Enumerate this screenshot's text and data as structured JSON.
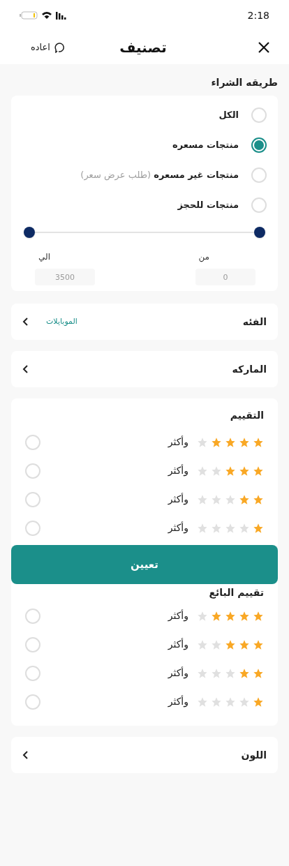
{
  "status_bar": {
    "time": "2:18"
  },
  "header": {
    "title": "تصنيف",
    "reset": "اعاده"
  },
  "purchase": {
    "title": "طريقه الشراء",
    "options": [
      {
        "label": "الكل",
        "selected": false
      },
      {
        "label": "منتجات مسعره",
        "selected": true
      },
      {
        "label": "منتجات غير مسعره",
        "note": "(طلب عرض سعر)",
        "selected": false
      },
      {
        "label": "منتجات للحجز",
        "selected": false
      }
    ],
    "from": {
      "label": "من",
      "placeholder": "0"
    },
    "to": {
      "label": "الي",
      "placeholder": "3500"
    }
  },
  "category": {
    "label": "الفئه",
    "value": "الموبايلات"
  },
  "brand": {
    "label": "الماركه"
  },
  "rating": {
    "title": "التقييم",
    "rows": [
      {
        "stars": 4,
        "label": "وأكثر",
        "selected": false
      },
      {
        "stars": 3,
        "label": "وأكثر",
        "selected": false
      },
      {
        "stars": 2,
        "label": "وأكثر",
        "selected": false
      },
      {
        "stars": 1,
        "label": "وأكثر",
        "selected": false
      }
    ]
  },
  "seller_rating": {
    "title": "تقييم البائع",
    "rows": [
      {
        "stars": 4,
        "label": "وأكثر",
        "selected": false
      },
      {
        "stars": 3,
        "label": "وأكثر",
        "selected": false
      },
      {
        "stars": 2,
        "label": "وأكثر",
        "selected": false
      },
      {
        "stars": 1,
        "label": "وأكثر",
        "selected": false
      }
    ]
  },
  "color": {
    "label": "اللون"
  },
  "apply_button": "تعيين"
}
